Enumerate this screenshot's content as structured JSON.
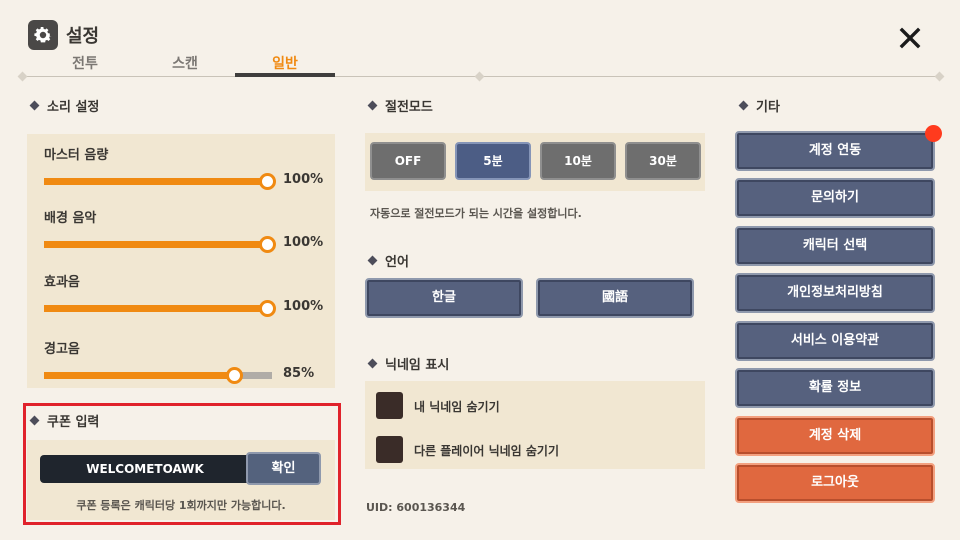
{
  "header": {
    "title": "설정",
    "gear_icon": "gear-icon",
    "close_icon": "close-icon"
  },
  "tabs": [
    {
      "label": "전투",
      "active": false
    },
    {
      "label": "스캔",
      "active": false
    },
    {
      "label": "일반",
      "active": true
    }
  ],
  "sound": {
    "title": "소리 설정",
    "sliders": [
      {
        "label": "마스터 음량",
        "value": 100,
        "value_text": "100%"
      },
      {
        "label": "배경 음악",
        "value": 100,
        "value_text": "100%"
      },
      {
        "label": "효과음",
        "value": 100,
        "value_text": "100%"
      },
      {
        "label": "경고음",
        "value": 85,
        "value_text": "85%"
      }
    ]
  },
  "coupon": {
    "title": "쿠폰 입력",
    "input_value": "WELCOMETOAWK",
    "confirm_label": "확인",
    "note": "쿠폰 등록은 캐릭터당 1회까지만 가능합니다."
  },
  "power_save": {
    "title": "절전모드",
    "options": [
      "OFF",
      "5분",
      "10분",
      "30분"
    ],
    "selected": "5분",
    "description": "자동으로 절전모드가 되는 시간을 설정합니다."
  },
  "language": {
    "title": "언어",
    "options": [
      "한글",
      "國語"
    ]
  },
  "nickname": {
    "title": "닉네임 표시",
    "options": [
      "내 닉네임 숨기기",
      "다른 플레이어 닉네임 숨기기"
    ]
  },
  "uid": "UID: 600136344",
  "etc": {
    "title": "기타",
    "buttons": [
      {
        "label": "계정 연동",
        "danger": false
      },
      {
        "label": "문의하기",
        "danger": false
      },
      {
        "label": "캐릭터 선택",
        "danger": false
      },
      {
        "label": "개인정보처리방침",
        "danger": false
      },
      {
        "label": "서비스 이용약관",
        "danger": false
      },
      {
        "label": "확률 정보",
        "danger": false
      },
      {
        "label": "계정 삭제",
        "danger": true
      },
      {
        "label": "로그아웃",
        "danger": true
      }
    ],
    "notification_color": "#ff3b1e"
  },
  "colors": {
    "accent": "#f08a12",
    "button_blue": "#56617e",
    "danger": "#e0683f",
    "highlight_border": "#e0222b"
  }
}
